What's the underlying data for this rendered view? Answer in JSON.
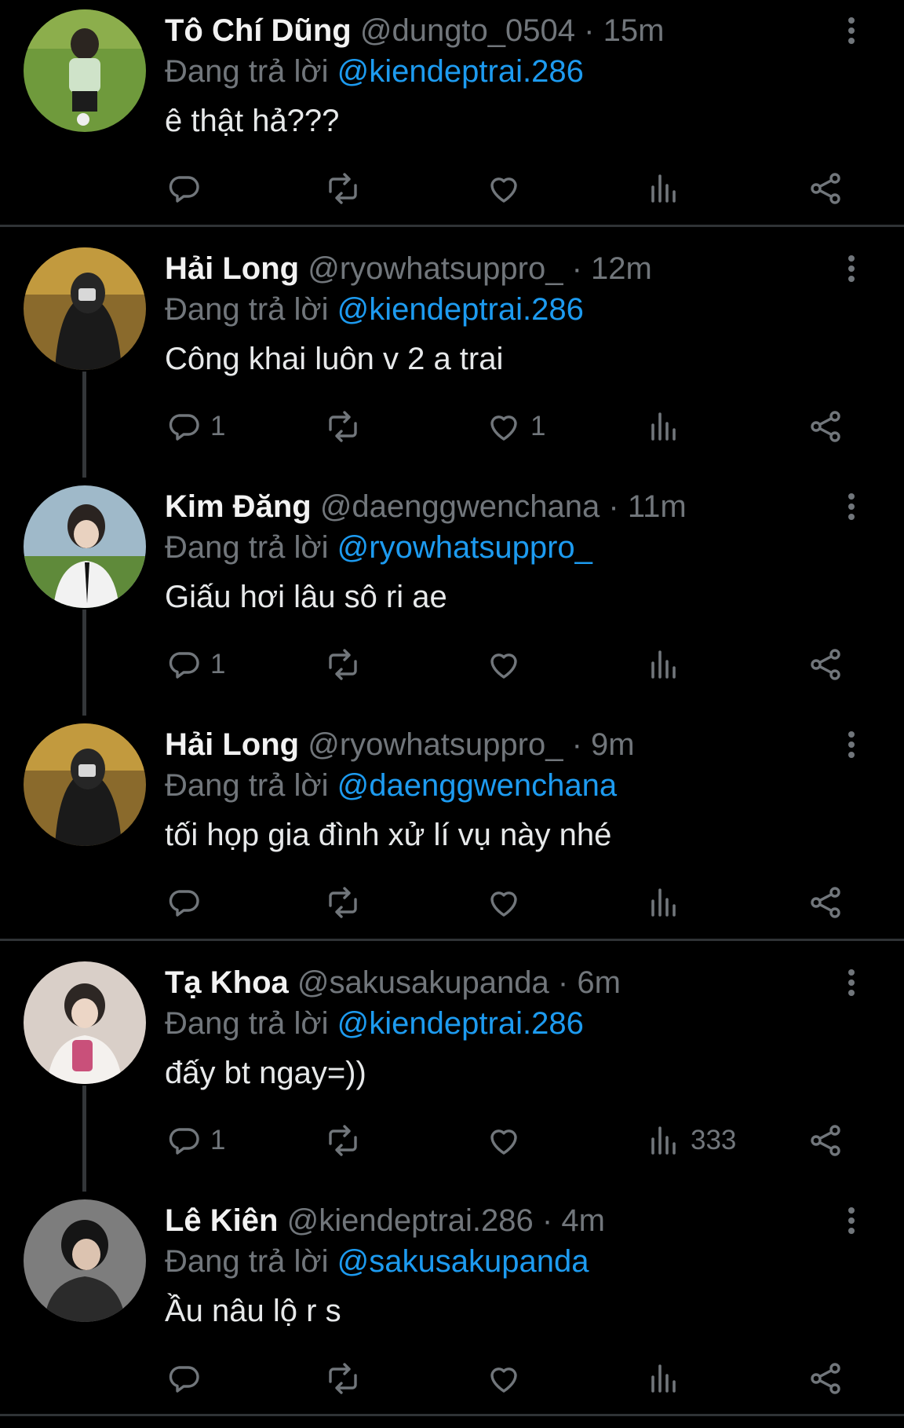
{
  "replying_label": "Đang trả lời",
  "separator": "·",
  "tweets": [
    {
      "name": "Tô Chí Dũng",
      "handle": "@dungto_0504",
      "time": "15m",
      "reply_to": "@kiendeptrai.286",
      "text": "ê thật hả???",
      "replies": "",
      "likes": "",
      "views": ""
    },
    {
      "name": "Hải Long",
      "handle": "@ryowhatsuppro_",
      "time": "12m",
      "reply_to": "@kiendeptrai.286",
      "text": "Công khai luôn v 2 a trai",
      "replies": "1",
      "likes": "1",
      "views": ""
    },
    {
      "name": "Kim Đăng",
      "handle": "@daenggwenchana",
      "time": "11m",
      "reply_to": "@ryowhatsuppro_",
      "text": "Giấu hơi lâu sô ri ae",
      "replies": "1",
      "likes": "",
      "views": ""
    },
    {
      "name": "Hải Long",
      "handle": "@ryowhatsuppro_",
      "time": "9m",
      "reply_to": "@daenggwenchana",
      "text": "tối họp gia đình xử lí vụ này nhé",
      "replies": "",
      "likes": "",
      "views": ""
    },
    {
      "name": "Tạ Khoa",
      "handle": "@sakusakupanda",
      "time": "6m",
      "reply_to": "@kiendeptrai.286",
      "text": "đấy bt ngay=))",
      "replies": "1",
      "likes": "",
      "views": "333"
    },
    {
      "name": "Lê Kiên",
      "handle": "@kiendeptrai.286",
      "time": "4m",
      "reply_to": "@sakusakupanda",
      "text": "Ầu nâu lộ r s",
      "replies": "",
      "likes": "",
      "views": ""
    }
  ],
  "icons": {
    "reply": "reply-icon",
    "retweet": "retweet-icon",
    "like": "heart-icon",
    "views": "views-icon",
    "share": "share-icon",
    "more": "more-icon"
  },
  "colors": {
    "background": "#000000",
    "muted": "#71767b",
    "link": "#1d9bf0",
    "divider": "#2f3336",
    "text": "#e7e9ea"
  }
}
